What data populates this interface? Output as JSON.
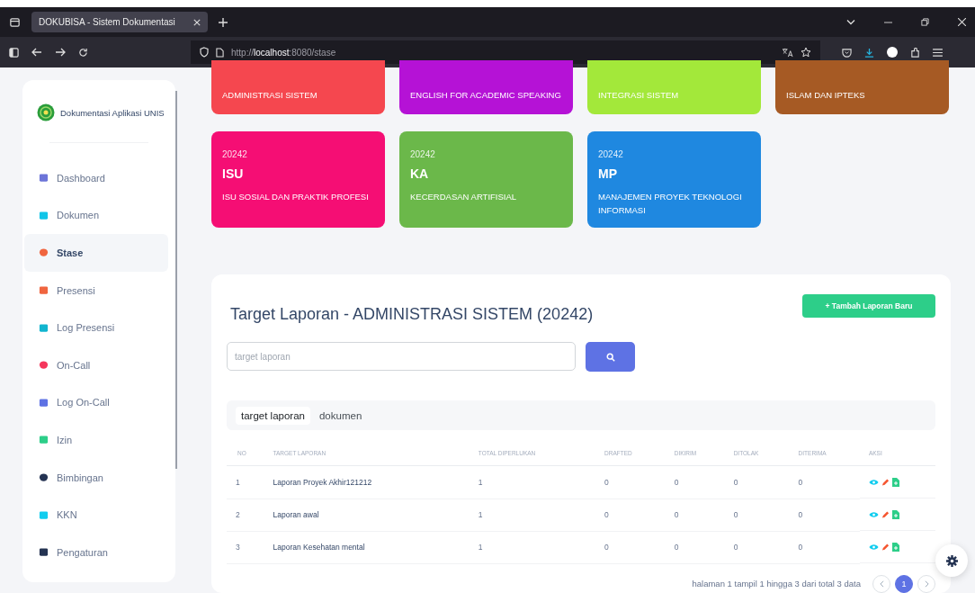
{
  "browser": {
    "tab_title": "DOKUBISA - Sistem Dokumentasi",
    "url_prefix": "http://",
    "url_host": "localhost",
    "url_rest": ":8080/stase"
  },
  "sidebar": {
    "brand": "Dokumentasi Aplikasi UNIS",
    "items": [
      {
        "label": "Dashboard",
        "selected": false,
        "color": "#6c74d8"
      },
      {
        "label": "Dokumen",
        "selected": false,
        "color": "#11c5e8"
      },
      {
        "label": "Stase",
        "selected": true,
        "color": "#f0653f"
      },
      {
        "label": "Presensi",
        "selected": false,
        "color": "#f0653f"
      },
      {
        "label": "Log Presensi",
        "selected": false,
        "color": "#11b5cf"
      },
      {
        "label": "On-Call",
        "selected": false,
        "color": "#f5365c"
      },
      {
        "label": "Log On-Call",
        "selected": false,
        "color": "#5e72e4"
      },
      {
        "label": "Izin",
        "selected": false,
        "color": "#2dce89"
      },
      {
        "label": "Bimbingan",
        "selected": false,
        "color": "#243352"
      },
      {
        "label": "KKN",
        "selected": false,
        "color": "#11cdef"
      },
      {
        "label": "Pengaturan",
        "selected": false,
        "color": "#243352"
      }
    ]
  },
  "stase_cards": [
    {
      "name": "ADMINISTRASI SISTEM",
      "color": "#f5474f"
    },
    {
      "name": "ENGLISH FOR ACADEMIC SPEAKING",
      "color": "#b512d6"
    },
    {
      "name": "INTEGRASI SISTEM",
      "color": "#a3e83a"
    },
    {
      "name": "ISLAM DAN IPTEKS",
      "color": "#a65a24"
    },
    {
      "period": "20242",
      "code": "ISU",
      "name": "ISU SOSIAL DAN PRAKTIK PROFESI",
      "color": "#f50e74"
    },
    {
      "period": "20242",
      "code": "KA",
      "name": "KECERDASAN ARTIFISIAL",
      "color": "#6bb84a"
    },
    {
      "period": "20242",
      "code": "MP",
      "name": "MANAJEMEN PROYEK TEKNOLOGI INFORMASI",
      "color": "#1f88e0"
    }
  ],
  "panel": {
    "title": "Target Laporan - ADMINISTRASI SISTEM (20242)",
    "add_button": "+ Tambah Laporan Baru",
    "search": {
      "placeholder": "target laporan"
    },
    "tabs": [
      {
        "label": "target laporan",
        "selected": true
      },
      {
        "label": "dokumen",
        "selected": false
      }
    ],
    "table": {
      "columns": [
        "NO",
        "TARGET LAPORAN",
        "TOTAL DIPERLUKAN",
        "DRAFTED",
        "DIKIRIM",
        "DITOLAK",
        "DITERIMA",
        "AKSI"
      ],
      "rows": [
        [
          "1",
          "Laporan Proyek Akhir121212",
          "1",
          "0",
          "0",
          "0",
          "0"
        ],
        [
          "2",
          "Laporan awal",
          "1",
          "0",
          "0",
          "0",
          "0"
        ],
        [
          "3",
          "Laporan Kesehatan mental",
          "1",
          "0",
          "0",
          "0",
          "0"
        ]
      ]
    },
    "footer": "halaman 1 tampil 1 hingga 3 dari total 3 data",
    "pages": [
      {
        "label": "1",
        "selected": true
      }
    ]
  }
}
